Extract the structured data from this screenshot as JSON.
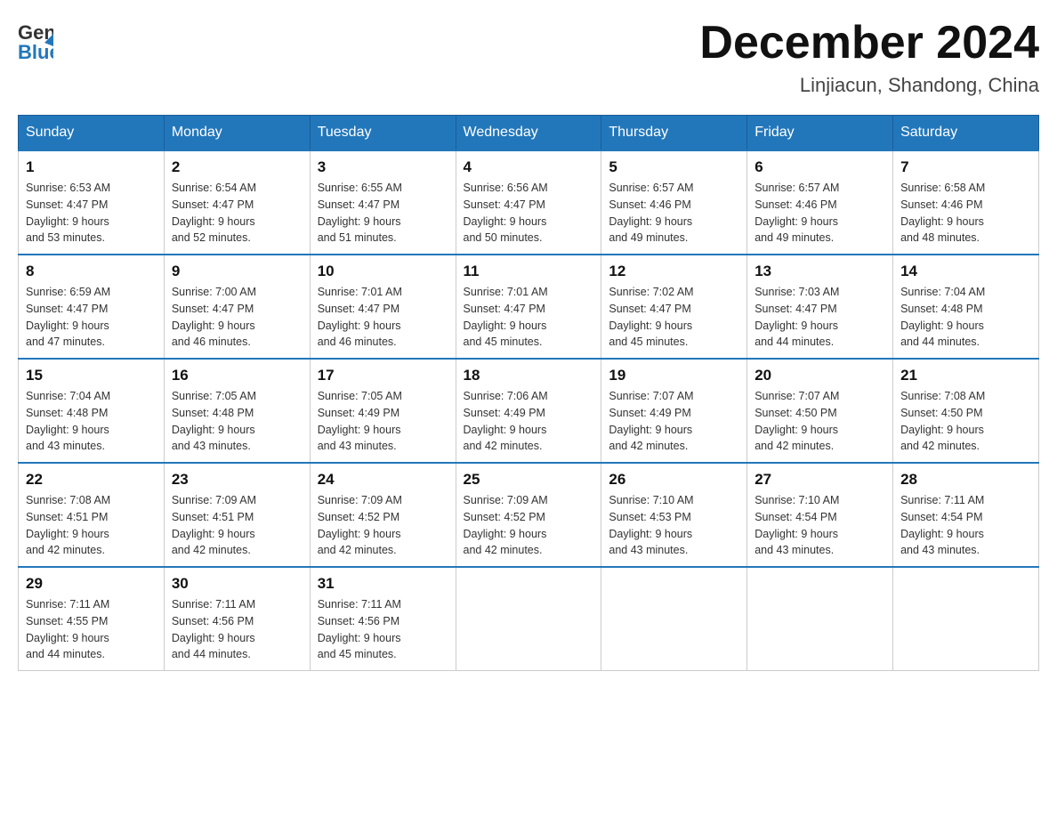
{
  "header": {
    "logo_general": "General",
    "logo_blue": "Blue",
    "title": "December 2024",
    "subtitle": "Linjiacun, Shandong, China"
  },
  "days_of_week": [
    "Sunday",
    "Monday",
    "Tuesday",
    "Wednesday",
    "Thursday",
    "Friday",
    "Saturday"
  ],
  "weeks": [
    [
      {
        "day": "1",
        "sunrise": "6:53 AM",
        "sunset": "4:47 PM",
        "daylight": "9 hours and 53 minutes."
      },
      {
        "day": "2",
        "sunrise": "6:54 AM",
        "sunset": "4:47 PM",
        "daylight": "9 hours and 52 minutes."
      },
      {
        "day": "3",
        "sunrise": "6:55 AM",
        "sunset": "4:47 PM",
        "daylight": "9 hours and 51 minutes."
      },
      {
        "day": "4",
        "sunrise": "6:56 AM",
        "sunset": "4:47 PM",
        "daylight": "9 hours and 50 minutes."
      },
      {
        "day": "5",
        "sunrise": "6:57 AM",
        "sunset": "4:46 PM",
        "daylight": "9 hours and 49 minutes."
      },
      {
        "day": "6",
        "sunrise": "6:57 AM",
        "sunset": "4:46 PM",
        "daylight": "9 hours and 49 minutes."
      },
      {
        "day": "7",
        "sunrise": "6:58 AM",
        "sunset": "4:46 PM",
        "daylight": "9 hours and 48 minutes."
      }
    ],
    [
      {
        "day": "8",
        "sunrise": "6:59 AM",
        "sunset": "4:47 PM",
        "daylight": "9 hours and 47 minutes."
      },
      {
        "day": "9",
        "sunrise": "7:00 AM",
        "sunset": "4:47 PM",
        "daylight": "9 hours and 46 minutes."
      },
      {
        "day": "10",
        "sunrise": "7:01 AM",
        "sunset": "4:47 PM",
        "daylight": "9 hours and 46 minutes."
      },
      {
        "day": "11",
        "sunrise": "7:01 AM",
        "sunset": "4:47 PM",
        "daylight": "9 hours and 45 minutes."
      },
      {
        "day": "12",
        "sunrise": "7:02 AM",
        "sunset": "4:47 PM",
        "daylight": "9 hours and 45 minutes."
      },
      {
        "day": "13",
        "sunrise": "7:03 AM",
        "sunset": "4:47 PM",
        "daylight": "9 hours and 44 minutes."
      },
      {
        "day": "14",
        "sunrise": "7:04 AM",
        "sunset": "4:48 PM",
        "daylight": "9 hours and 44 minutes."
      }
    ],
    [
      {
        "day": "15",
        "sunrise": "7:04 AM",
        "sunset": "4:48 PM",
        "daylight": "9 hours and 43 minutes."
      },
      {
        "day": "16",
        "sunrise": "7:05 AM",
        "sunset": "4:48 PM",
        "daylight": "9 hours and 43 minutes."
      },
      {
        "day": "17",
        "sunrise": "7:05 AM",
        "sunset": "4:49 PM",
        "daylight": "9 hours and 43 minutes."
      },
      {
        "day": "18",
        "sunrise": "7:06 AM",
        "sunset": "4:49 PM",
        "daylight": "9 hours and 42 minutes."
      },
      {
        "day": "19",
        "sunrise": "7:07 AM",
        "sunset": "4:49 PM",
        "daylight": "9 hours and 42 minutes."
      },
      {
        "day": "20",
        "sunrise": "7:07 AM",
        "sunset": "4:50 PM",
        "daylight": "9 hours and 42 minutes."
      },
      {
        "day": "21",
        "sunrise": "7:08 AM",
        "sunset": "4:50 PM",
        "daylight": "9 hours and 42 minutes."
      }
    ],
    [
      {
        "day": "22",
        "sunrise": "7:08 AM",
        "sunset": "4:51 PM",
        "daylight": "9 hours and 42 minutes."
      },
      {
        "day": "23",
        "sunrise": "7:09 AM",
        "sunset": "4:51 PM",
        "daylight": "9 hours and 42 minutes."
      },
      {
        "day": "24",
        "sunrise": "7:09 AM",
        "sunset": "4:52 PM",
        "daylight": "9 hours and 42 minutes."
      },
      {
        "day": "25",
        "sunrise": "7:09 AM",
        "sunset": "4:52 PM",
        "daylight": "9 hours and 42 minutes."
      },
      {
        "day": "26",
        "sunrise": "7:10 AM",
        "sunset": "4:53 PM",
        "daylight": "9 hours and 43 minutes."
      },
      {
        "day": "27",
        "sunrise": "7:10 AM",
        "sunset": "4:54 PM",
        "daylight": "9 hours and 43 minutes."
      },
      {
        "day": "28",
        "sunrise": "7:11 AM",
        "sunset": "4:54 PM",
        "daylight": "9 hours and 43 minutes."
      }
    ],
    [
      {
        "day": "29",
        "sunrise": "7:11 AM",
        "sunset": "4:55 PM",
        "daylight": "9 hours and 44 minutes."
      },
      {
        "day": "30",
        "sunrise": "7:11 AM",
        "sunset": "4:56 PM",
        "daylight": "9 hours and 44 minutes."
      },
      {
        "day": "31",
        "sunrise": "7:11 AM",
        "sunset": "4:56 PM",
        "daylight": "9 hours and 45 minutes."
      },
      null,
      null,
      null,
      null
    ]
  ],
  "labels": {
    "sunrise": "Sunrise:",
    "sunset": "Sunset:",
    "daylight": "Daylight:"
  }
}
